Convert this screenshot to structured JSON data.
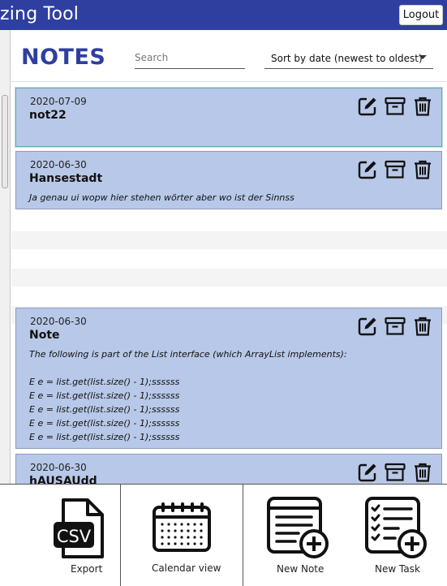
{
  "titlebar": {
    "app_title": "zing Tool",
    "logout_label": "Logout"
  },
  "header": {
    "title": "NOTES",
    "search_placeholder": "Search",
    "sort_selected": "Sort by date (newest to oldest)"
  },
  "notes": [
    {
      "date": "2020-07-09",
      "title": "not22",
      "body": ""
    },
    {
      "date": "2020-06-30",
      "title": "Hansestadt",
      "body": "Ja genau ui wopw hier stehen wörter aber wo ist der Sinnss"
    },
    {
      "date": "2020-06-30",
      "title": "Note",
      "body": "The following is part of the List interface (which ArrayList implements):\n\nE e = list.get(list.size() - 1);ssssss\nE e = list.get(list.size() - 1);ssssss\nE e = list.get(list.size() - 1);ssssss\nE e = list.get(list.size() - 1);ssssss\nE e = list.get(list.size() - 1);ssssss"
    },
    {
      "date": "2020-06-30",
      "title": "hAUSAUdd",
      "body": ""
    }
  ],
  "toolbar": {
    "export_label": "Export",
    "csv_text": "CSV",
    "calendar_label": "Calendar view",
    "new_note_label": "New Note",
    "new_task_label": "New Task"
  },
  "icons": {
    "edit": "edit-icon",
    "archive": "archive-icon",
    "trash": "trash-icon",
    "csv": "csv-file-icon",
    "calendar": "calendar-icon",
    "new_note": "new-note-icon",
    "new_task": "new-task-icon"
  },
  "colors": {
    "brand": "#2f3fa0",
    "card_bg": "#b8c8e8",
    "selected_border": "#5fb0a5"
  }
}
